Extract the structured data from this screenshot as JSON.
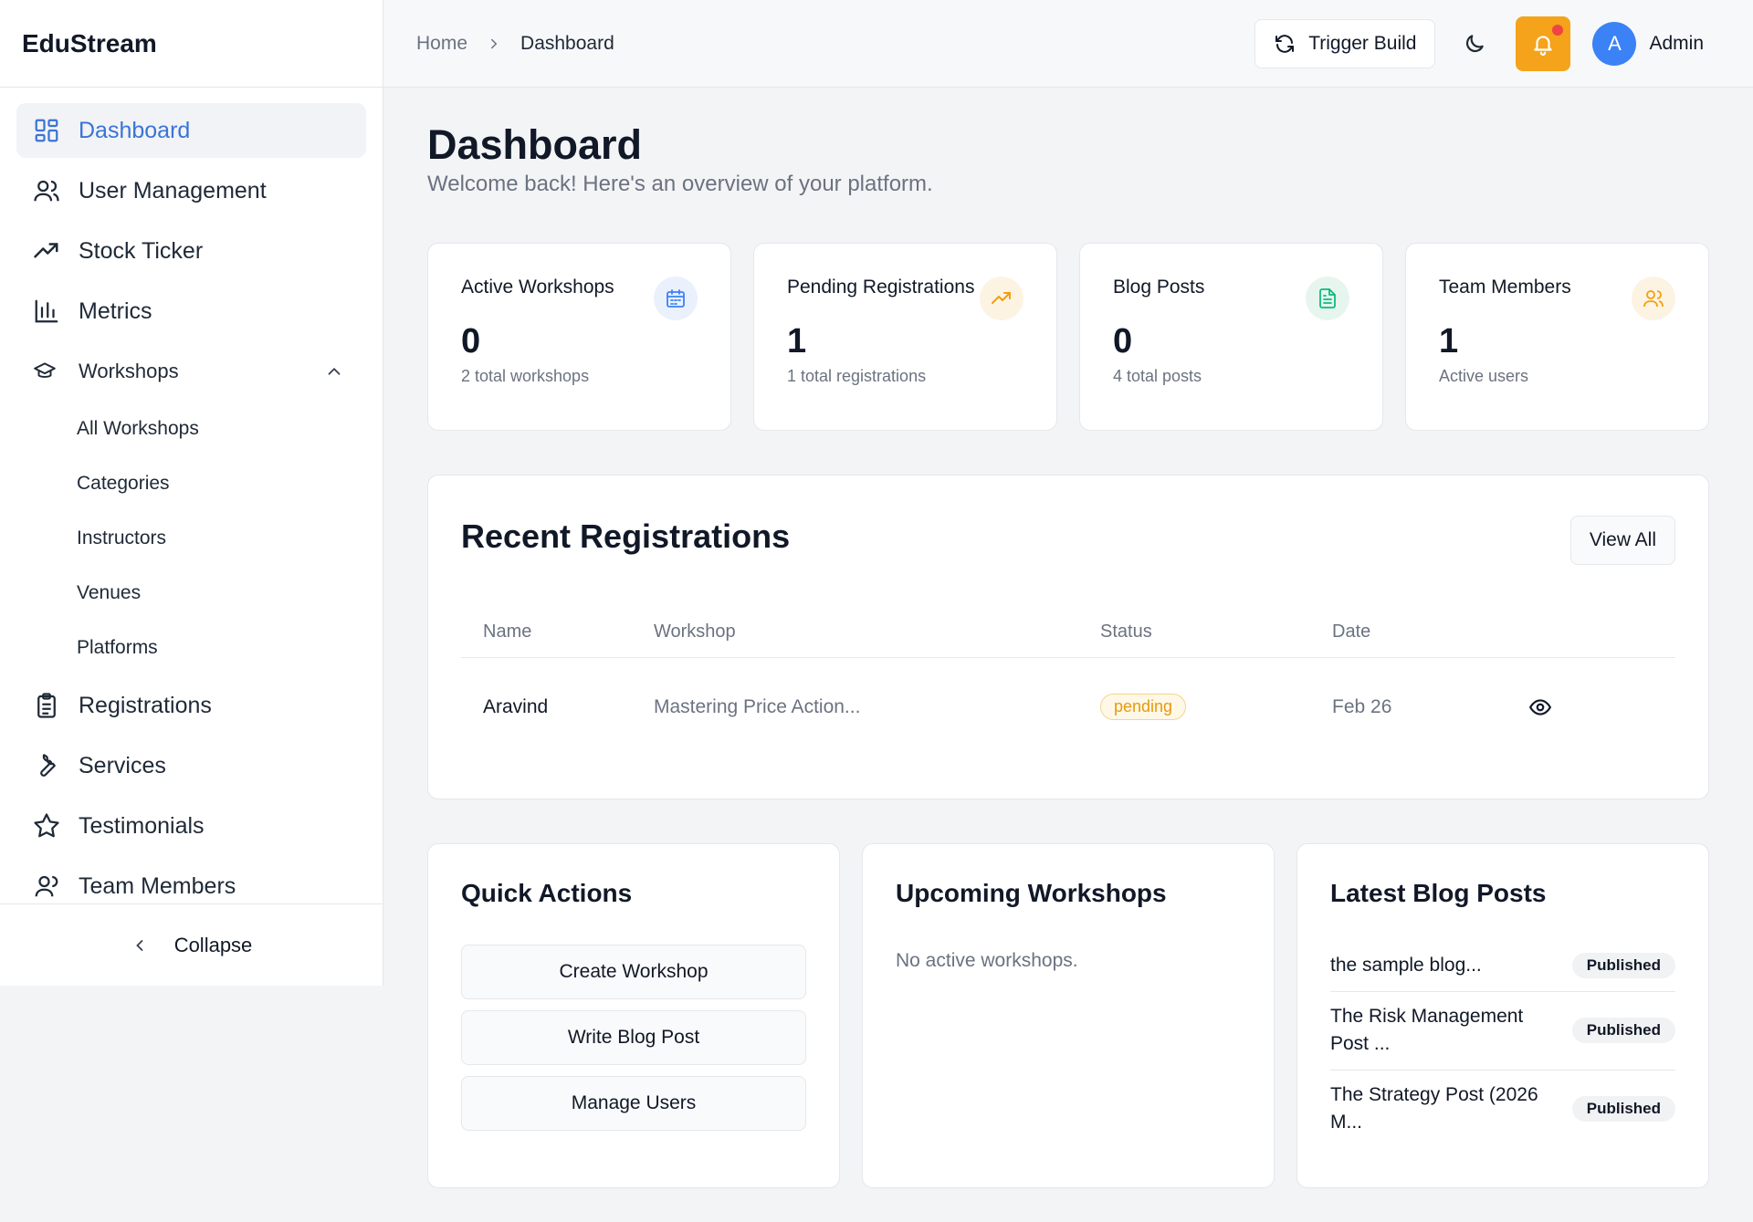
{
  "app": {
    "brand": "EduStream"
  },
  "sidebar": {
    "items": [
      {
        "label": "Dashboard",
        "icon": "dashboard-grid-icon",
        "active": true
      },
      {
        "label": "User Management",
        "icon": "users-icon"
      },
      {
        "label": "Stock Ticker",
        "icon": "trending-up-icon"
      },
      {
        "label": "Metrics",
        "icon": "bar-chart-icon"
      }
    ],
    "workshops": {
      "label": "Workshops",
      "icon": "graduation-cap-icon",
      "expanded": true,
      "children": [
        "All Workshops",
        "Categories",
        "Instructors",
        "Venues",
        "Platforms"
      ]
    },
    "items_after": [
      {
        "label": "Registrations",
        "icon": "clipboard-icon"
      },
      {
        "label": "Services",
        "icon": "wrench-icon"
      },
      {
        "label": "Testimonials",
        "icon": "star-icon"
      },
      {
        "label": "Team Members",
        "icon": "user-icon"
      }
    ],
    "collapse_label": "Collapse"
  },
  "topbar": {
    "breadcrumb": {
      "home": "Home",
      "current": "Dashboard"
    },
    "trigger_build": "Trigger Build",
    "user": {
      "initial": "A",
      "name": "Admin"
    },
    "colors": {
      "bell_bg": "#f5a31a",
      "avatar_bg": "#3b82f6",
      "notification_dot": "#ef4444"
    }
  },
  "page": {
    "title": "Dashboard",
    "subtitle": "Welcome back! Here's an overview of your platform."
  },
  "stats": [
    {
      "label": "Active Workshops",
      "value": "0",
      "hint": "2 total workshops",
      "icon": "calendar-icon",
      "color": "#3b82f6",
      "bg": "#eaf1fd"
    },
    {
      "label": "Pending Registrations",
      "value": "1",
      "hint": "1 total registrations",
      "icon": "trending-up-icon",
      "color": "#f59e0b",
      "bg": "#fdf3e3"
    },
    {
      "label": "Blog Posts",
      "value": "0",
      "hint": "4 total posts",
      "icon": "document-icon",
      "color": "#10b981",
      "bg": "#e6f6ef"
    },
    {
      "label": "Team Members",
      "value": "1",
      "hint": "Active users",
      "icon": "users-icon",
      "color": "#f59e0b",
      "bg": "#fdf3e3"
    }
  ],
  "recent": {
    "title": "Recent Registrations",
    "view_all": "View All",
    "columns": [
      "Name",
      "Workshop",
      "Status",
      "Date"
    ],
    "rows": [
      {
        "name": "Aravind",
        "workshop": "Mastering Price Action...",
        "status": "pending",
        "date": "Feb 26"
      }
    ]
  },
  "quick_actions": {
    "title": "Quick Actions",
    "buttons": [
      "Create Workshop",
      "Write Blog Post",
      "Manage Users"
    ]
  },
  "upcoming": {
    "title": "Upcoming Workshops",
    "empty": "No active workshops."
  },
  "blog": {
    "title": "Latest Blog Posts",
    "posts": [
      {
        "title": "the sample blog...",
        "status": "Published"
      },
      {
        "title": "The Risk Management Post ...",
        "status": "Published"
      },
      {
        "title": "The Strategy Post (2026 M...",
        "status": "Published"
      }
    ]
  }
}
